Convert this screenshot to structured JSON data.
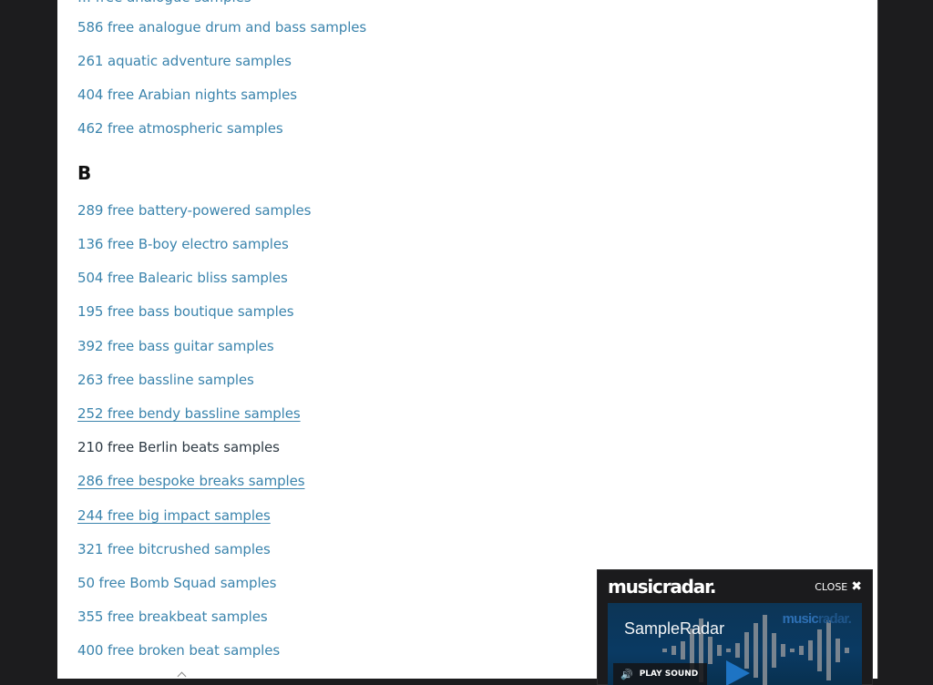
{
  "list": {
    "cut_item": "… free analogue samples",
    "section_a_items": [
      {
        "label": "586 free analogue drum and bass samples",
        "style": "link"
      },
      {
        "label": "261 aquatic adventure samples",
        "style": "link"
      },
      {
        "label": "404 free Arabian nights samples",
        "style": "link"
      },
      {
        "label": "462 free atmospheric samples",
        "style": "link"
      }
    ],
    "section_b_heading": "B",
    "section_b_items": [
      {
        "label": "289 free battery-powered samples",
        "style": "link"
      },
      {
        "label": "136 free B-boy electro samples",
        "style": "link"
      },
      {
        "label": "504 free Balearic bliss samples",
        "style": "link"
      },
      {
        "label": "195 free bass boutique samples",
        "style": "link"
      },
      {
        "label": "392 free bass guitar samples",
        "style": "link"
      },
      {
        "label": "263 free bassline samples",
        "style": "link"
      },
      {
        "label": "252 free bendy bassline samples",
        "style": "underlined"
      },
      {
        "label": "210 free Berlin beats samples",
        "style": "hovered"
      },
      {
        "label": "286 free bespoke breaks samples",
        "style": "underlined"
      },
      {
        "label": "244 free big impact samples",
        "style": "underlined"
      },
      {
        "label": "321 free bitcrushed samples",
        "style": "link"
      },
      {
        "label": "50 free Bomb Squad samples",
        "style": "link"
      },
      {
        "label": "355 free breakbeat samples",
        "style": "link"
      },
      {
        "label": "400 free broken beat samples",
        "style": "link"
      }
    ]
  },
  "popup": {
    "logo": "musicradar.",
    "close_label": "CLOSE",
    "close_icon": "close-x-icon",
    "video_title": "SampleRadar",
    "video_brand_a": "music",
    "video_brand_b": "radar.",
    "play_sound_label": "PLAY SOUND",
    "speaker_icon": "speaker-icon",
    "play_icon": "play-icon"
  },
  "colors": {
    "link": "#3b84ad",
    "hovered_text": "#2e3a44",
    "backdrop": "#1c1c1e",
    "popup_bg": "#1b1b1d",
    "video_bg": "#0a3a63",
    "play_accent": "#1e74c4"
  }
}
